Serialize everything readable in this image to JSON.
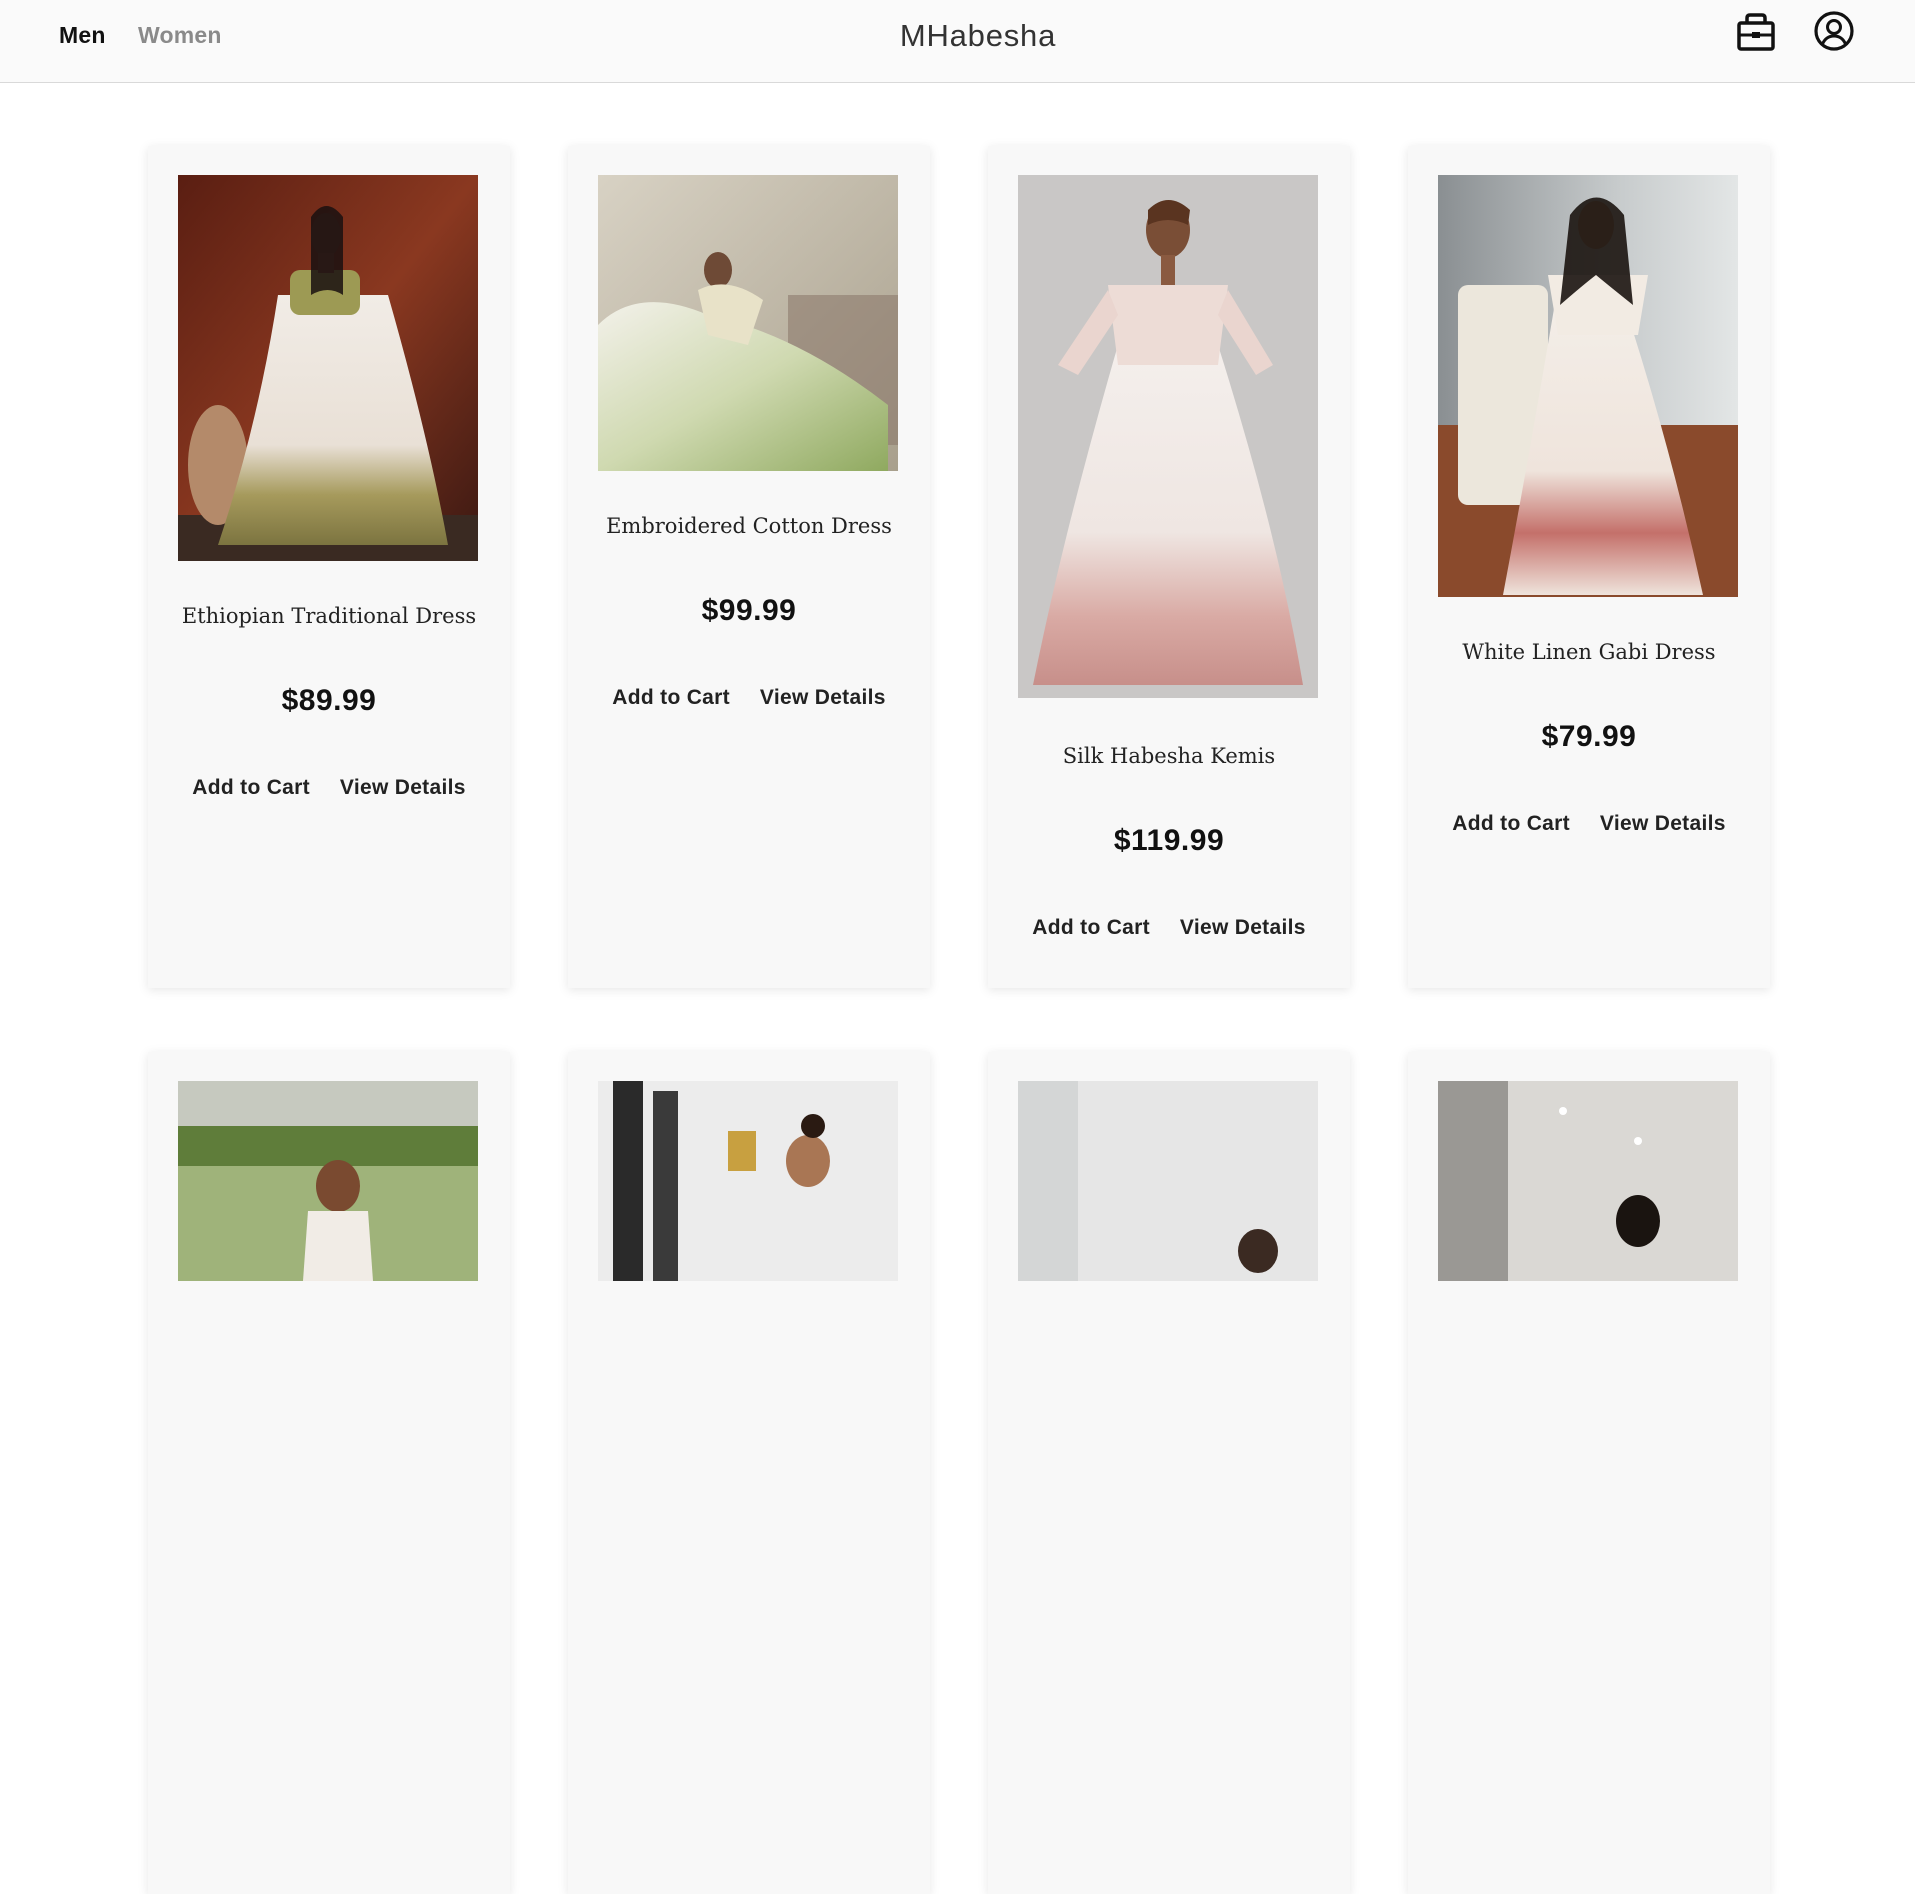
{
  "header": {
    "nav": [
      {
        "label": "Men",
        "active": true
      },
      {
        "label": "Women",
        "active": false
      }
    ],
    "brand": "MHabesha",
    "icons": [
      "cart-icon",
      "account-icon"
    ]
  },
  "products": [
    {
      "name": "Ethiopian Traditional Dress",
      "price": "$89.99",
      "add_label": "Add to Cart",
      "details_label": "View Details"
    },
    {
      "name": "Embroidered Cotton Dress",
      "price": "$99.99",
      "add_label": "Add to Cart",
      "details_label": "View Details"
    },
    {
      "name": "Silk Habesha Kemis",
      "price": "$119.99",
      "add_label": "Add to Cart",
      "details_label": "View Details"
    },
    {
      "name": "White Linen Gabi Dress",
      "price": "$79.99",
      "add_label": "Add to Cart",
      "details_label": "View Details"
    }
  ],
  "colors": {
    "accent": "#111111",
    "muted": "#8a8a8a",
    "card_bg": "#f8f8f8"
  }
}
